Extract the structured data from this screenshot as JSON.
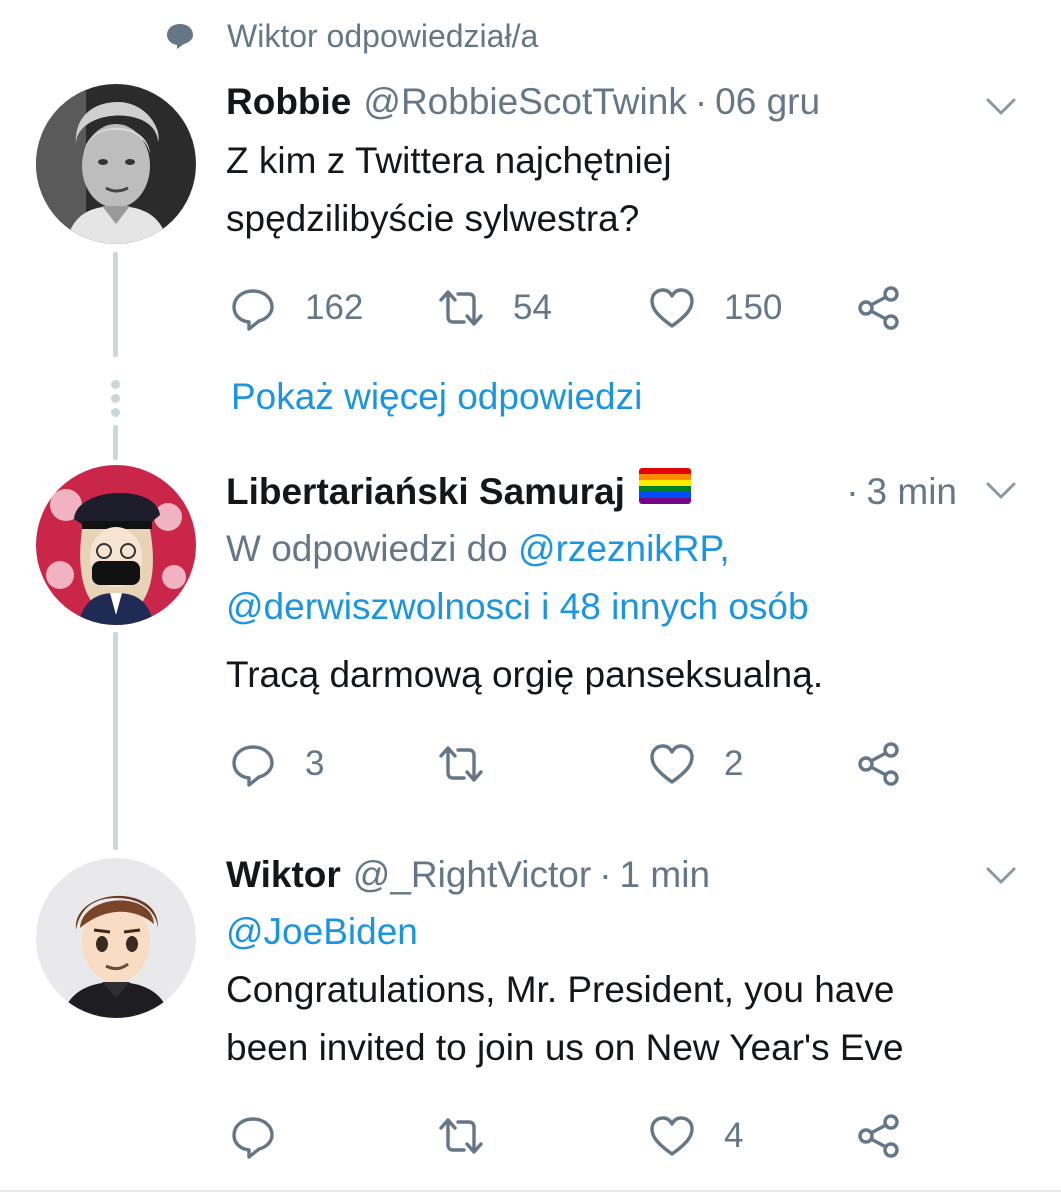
{
  "context": {
    "text": "Wiktor odpowiedział/a",
    "icon": "speech-bubble-icon"
  },
  "thread": {
    "show_more_label": "Pokaż więcej odpowiedzi",
    "tweets": [
      {
        "name": "Robbie",
        "handle": "@RobbieScotTwink",
        "separator": "·",
        "time": "06 gru",
        "body_lines": [
          "Z kim z Twittera najchętniej",
          "spędzilibyście sylwestra?"
        ],
        "replies": "162",
        "retweets": "54",
        "likes": "150"
      },
      {
        "name": "Libertariański Samuraj",
        "flag": "rainbow-flag-emoji",
        "handle": "",
        "separator": "·",
        "time": "3 min",
        "reply_to_prefix": "W odpowiedzi do ",
        "reply_to_first": "@rzeznikRP,",
        "reply_to_second": "@derwiszwolnosci i 48 innych osób",
        "body_lines": [
          "Tracą darmową orgię panseksualną."
        ],
        "replies": "3",
        "retweets": "",
        "likes": "2"
      },
      {
        "name": "Wiktor",
        "handle": "@_RightVictor",
        "separator": "·",
        "time": "1 min",
        "mention": "@JoeBiden",
        "body_lines": [
          "Congratulations, Mr. President, you have",
          "been invited to join us on New Year's Eve"
        ],
        "replies": "",
        "retweets": "",
        "likes": "4"
      }
    ]
  },
  "colors": {
    "text_primary": "#14171a",
    "text_secondary": "#657786",
    "link": "#1b95e0",
    "thread_line": "#ccd6dd"
  },
  "icons": [
    "speech-bubble-icon",
    "chevron-down-icon",
    "reply-icon",
    "retweet-icon",
    "heart-icon",
    "share-icon"
  ]
}
